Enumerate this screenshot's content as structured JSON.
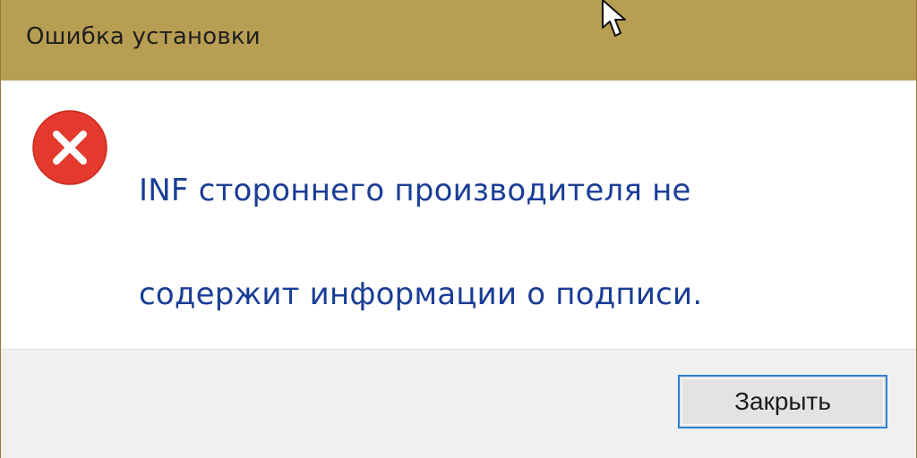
{
  "window": {
    "title": "Ошибка установки"
  },
  "dialog": {
    "icon": "error-icon",
    "message_line_1": "INF стороннего производителя не",
    "message_line_2": "содержит информации о подписи."
  },
  "footer": {
    "close_button_label": "Закрыть"
  },
  "colors": {
    "titlebar": "#b89e52",
    "message_text": "#1a3e96",
    "error_red": "#e43a2d",
    "button_focus_border": "#2b7fd6"
  }
}
